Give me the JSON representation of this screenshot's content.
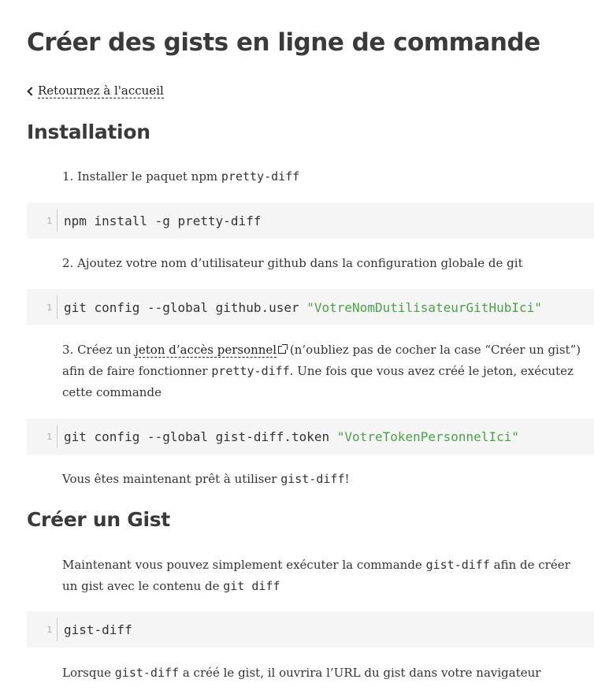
{
  "title": "Créer des gists en ligne de commande",
  "back_link": "Retournez à l'accueil",
  "sections": {
    "installation": "Installation",
    "create_gist": "Créer un Gist"
  },
  "steps": {
    "s1_text": "1. Installer le paquet npm ",
    "s1_code": "pretty-diff",
    "code1": "npm install -g pretty-diff",
    "s2_text": "2. Ajoutez votre nom d’utilisateur github dans la configuration globale de git",
    "code2_cmd": "git config --global github.user ",
    "code2_str": "\"VotreNomDutilisateurGitHubIci\"",
    "s3_pre": "3. Créez un ",
    "s3_link": "jeton d’accès personnel",
    "s3_mid": " (n’oubliez pas de cocher la case “Créer un gist”) afin de faire fonctionner ",
    "s3_code": "pretty-diff",
    "s3_post": ". Une fois que vous avez créé le jeton, exécutez cette commande",
    "code3_cmd": "git config --global gist-diff.token ",
    "code3_str": "\"VotreTokenPersonnelIci\"",
    "ready_pre": "Vous êtes maintenant prêt à utiliser ",
    "ready_code": "gist-diff",
    "ready_post": "!"
  },
  "gist": {
    "p1_pre": "Maintenant vous pouvez simplement exécuter la commande ",
    "p1_code": "gist-diff",
    "p1_mid": " afin de créer un gist avec le contenu de ",
    "p1_code2": "git diff",
    "code4": "gist-diff",
    "p2_pre": "Lorsque ",
    "p2_code": "gist-diff",
    "p2_post": " a créé le gist, il ouvrira l’URL du gist dans votre navigateur"
  },
  "line_number": "1",
  "icons": {
    "back": "chevron-left-icon",
    "external": "external-link-icon"
  },
  "colors": {
    "code_bg": "#f5f5f5",
    "string": "#4aa34a",
    "heading": "#3a3a3a"
  }
}
